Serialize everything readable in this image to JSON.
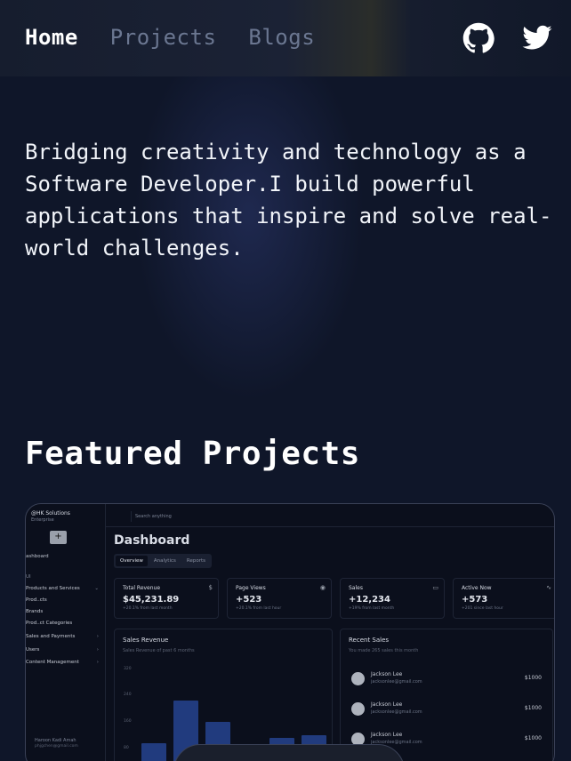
{
  "nav": {
    "links": [
      {
        "label": "Home",
        "active": true
      },
      {
        "label": "Projects",
        "active": false
      },
      {
        "label": "Blogs",
        "active": false
      }
    ],
    "icons": [
      "github-icon",
      "twitter-icon"
    ]
  },
  "hero": {
    "text": "Bridging creativity and technology as a Software Developer.I build powerful applications that inspire and solve real-world challenges."
  },
  "featured": {
    "title": "Featured Projects"
  },
  "project_preview": {
    "org_name": "@HK Solutions",
    "org_plan": "Enterprise",
    "sidebar_top_label": "ashboard",
    "sidebar_section_label": "UI",
    "sidebar_items": [
      {
        "label": "Products and Services",
        "chevron": "⌄"
      },
      {
        "label": "Prod..cts",
        "chevron": ""
      },
      {
        "label": "Brands",
        "chevron": ""
      },
      {
        "label": "Prod..ct Categories",
        "chevron": ""
      },
      {
        "label": "Sales and Payments",
        "chevron": "›"
      },
      {
        "label": "Users",
        "chevron": "›"
      },
      {
        "label": "Content Management",
        "chevron": "›"
      }
    ],
    "user_name": "Haroon Kadi Amah",
    "user_email": "phjgchen@gmail.com",
    "search_placeholder": "Search anything",
    "dashboard_title": "Dashboard",
    "tabs": [
      "Overview",
      "Analytics",
      "Reports"
    ],
    "stats": [
      {
        "title": "Total Revenue",
        "value": "$45,231.89",
        "sub": "+20.1% from last month",
        "icon": "$"
      },
      {
        "title": "Page Views",
        "value": "+523",
        "sub": "+20.1% from last hour",
        "icon": "◉"
      },
      {
        "title": "Sales",
        "value": "+12,234",
        "sub": "+19% from last month",
        "icon": "▭"
      },
      {
        "title": "Active Now",
        "value": "+573",
        "sub": "+201 since last hour",
        "icon": "∿"
      }
    ],
    "revenue_panel": {
      "title": "Sales Revenue",
      "subtitle": "Sales Revenue of past 6 months",
      "y_labels": [
        "320",
        "240",
        "160",
        "80"
      ],
      "bars": [
        0.38,
        0.82,
        0.6,
        0,
        0.44,
        0.46
      ]
    },
    "recent_sales": {
      "title": "Recent Sales",
      "subtitle": "You made 265 sales this month",
      "rows": [
        {
          "name": "Jackson Lee",
          "email": "jacksonlee@gmail.com",
          "amount": "$1000"
        },
        {
          "name": "Jackson Lee",
          "email": "jacksonlee@gmail.com",
          "amount": "$1000"
        },
        {
          "name": "Jackson Lee",
          "email": "jacksonlee@gmail.com",
          "amount": "$1000"
        }
      ]
    }
  }
}
